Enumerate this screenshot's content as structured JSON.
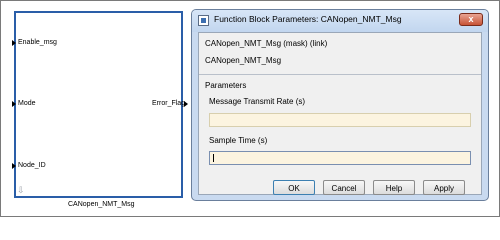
{
  "block": {
    "name": "CANopen_NMT_Msg",
    "inputs": [
      "Enable_msg",
      "Mode",
      "Node_ID"
    ],
    "output": "Error_Flag"
  },
  "dialog": {
    "title": "Function Block Parameters: CANopen_NMT_Msg",
    "close_glyph": "x",
    "mask_title": "CANopen_NMT_Msg (mask) (link)",
    "mask_description": "CANopen_NMT_Msg",
    "section": "Parameters",
    "params": [
      {
        "label": "Message Transmit Rate (s)",
        "value": ""
      },
      {
        "label": "Sample Time (s)",
        "value": ""
      }
    ],
    "buttons": {
      "ok": "OK",
      "cancel": "Cancel",
      "help": "Help",
      "apply": "Apply"
    }
  },
  "colors": {
    "block_border": "#2a5ea8",
    "dialog_frame": "#c9daf0",
    "field_bg": "#fcf4e0"
  }
}
